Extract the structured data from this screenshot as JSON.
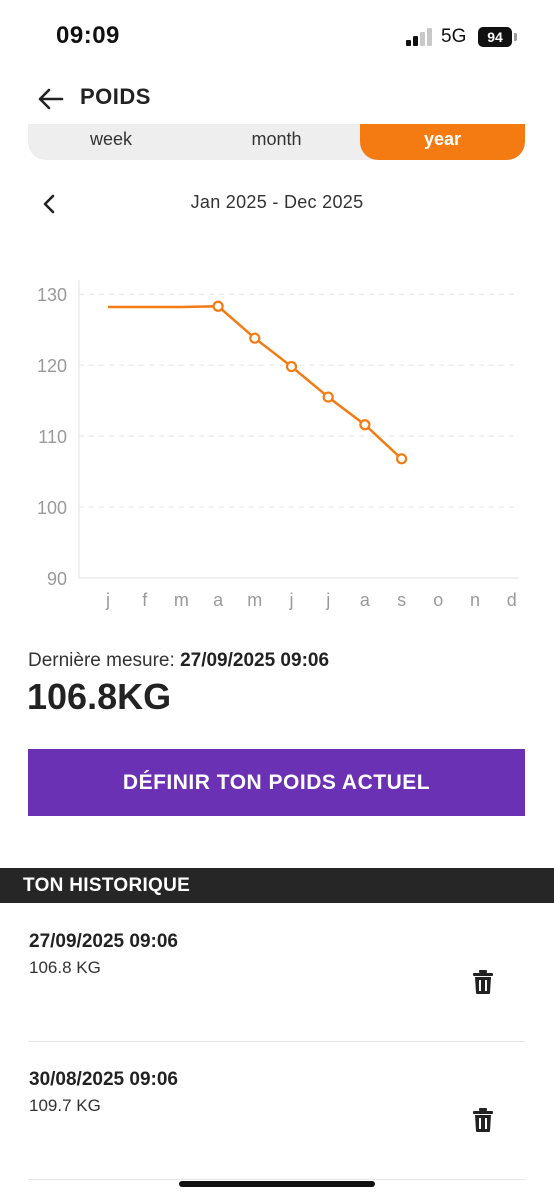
{
  "status": {
    "time": "09:09",
    "network": "5G",
    "battery": "94"
  },
  "header": {
    "title": "POIDS",
    "back_icon": "arrow-left-icon"
  },
  "period_tabs": [
    {
      "label": "week",
      "active": false
    },
    {
      "label": "month",
      "active": false
    },
    {
      "label": "year",
      "active": true
    }
  ],
  "period": {
    "label": "Jan 2025 - Dec 2025",
    "prev_icon": "chevron-left-icon"
  },
  "chart_data": {
    "type": "line",
    "categories": [
      "j",
      "f",
      "m",
      "a",
      "m",
      "j",
      "j",
      "a",
      "s",
      "o",
      "n",
      "d"
    ],
    "series": [
      {
        "values": [
          128.2,
          128.2,
          128.2,
          128.3,
          123.8,
          119.8,
          115.5,
          111.6,
          106.8,
          null,
          null,
          null
        ]
      }
    ],
    "markers_from_index": 3,
    "yticks": [
      90,
      100,
      110,
      120,
      130
    ],
    "ylim": [
      90,
      132
    ],
    "grid": true,
    "color": "#f47a12"
  },
  "last_measure": {
    "label": "Dernière mesure:",
    "datetime": "27/09/2025 09:06"
  },
  "current_weight": "106.8KG",
  "set_weight_button": "DÉFINIR TON POIDS ACTUEL",
  "history": {
    "title": "TON HISTORIQUE",
    "items": [
      {
        "datetime": "27/09/2025 09:06",
        "weight": "106.8 KG",
        "icon": "trash-icon"
      },
      {
        "datetime": "30/08/2025 09:06",
        "weight": "109.7 KG",
        "icon": "trash-icon"
      }
    ]
  },
  "colors": {
    "accent": "#f47a12",
    "primary_button": "#6a31b5",
    "history_header": "#262626"
  }
}
